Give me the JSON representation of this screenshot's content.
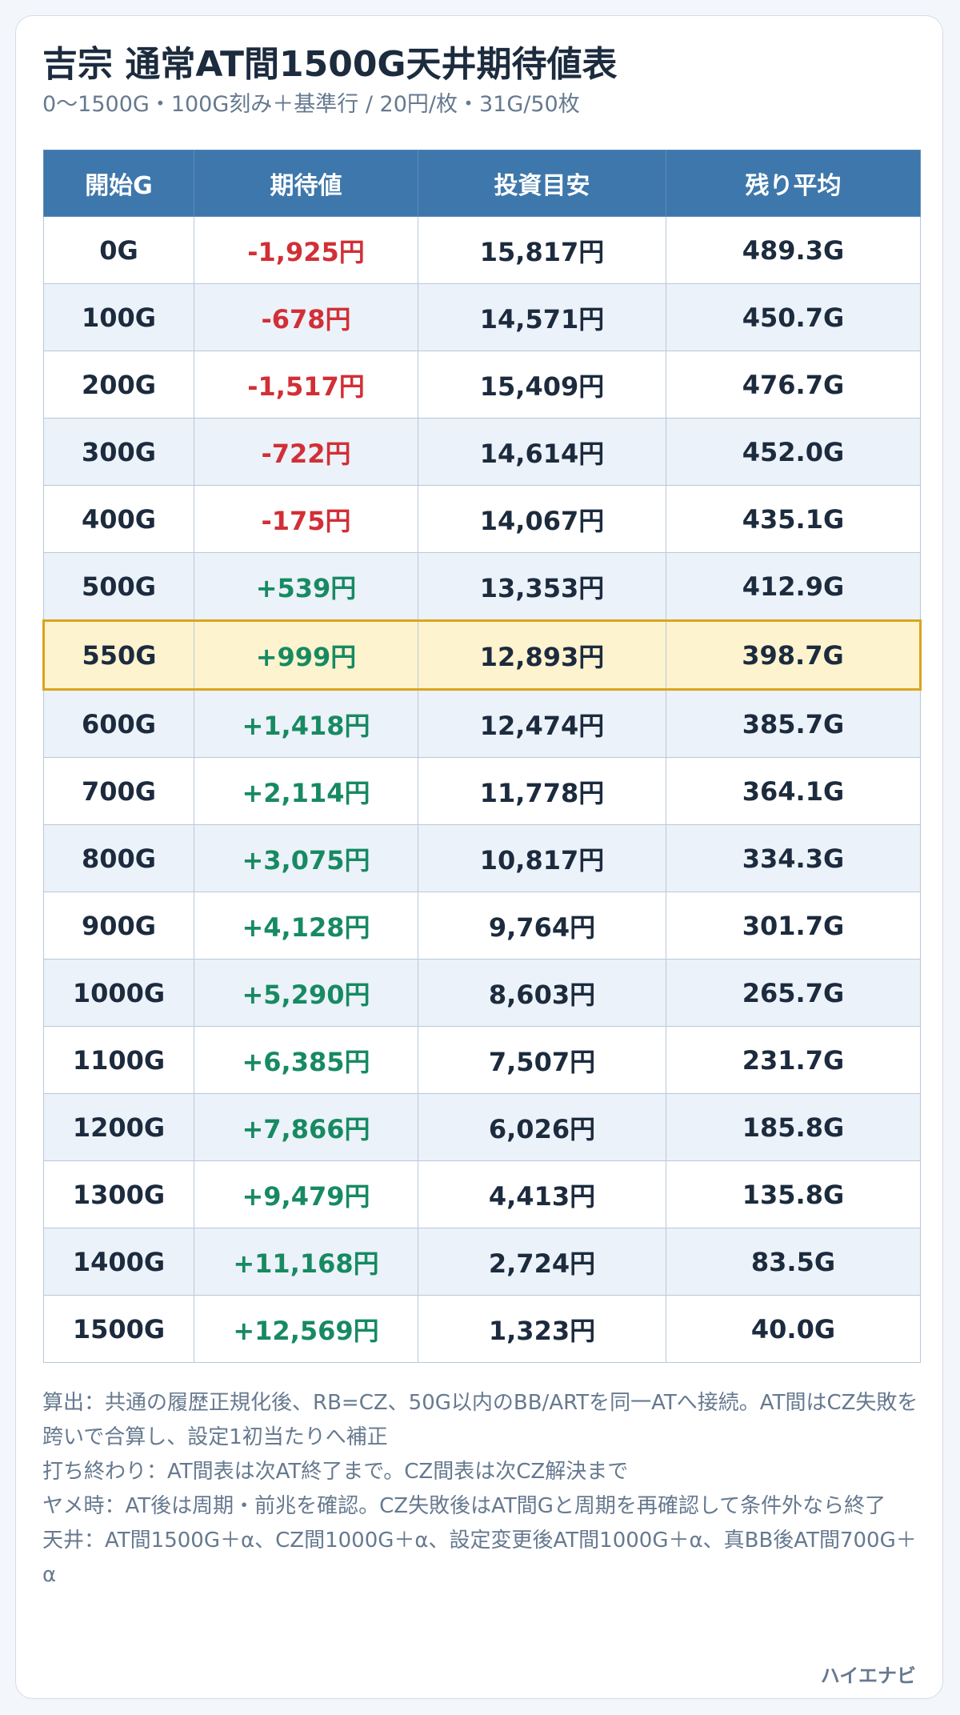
{
  "title": "吉宗 通常AT間1500G天井期待値表",
  "subtitle": "0〜1500G・100G刻み＋基準行 / 20円/枚・31G/50枚",
  "table": {
    "headers": [
      "開始G",
      "期待値",
      "投資目安",
      "残り平均"
    ],
    "rows": [
      {
        "start": "0G",
        "ev": "-1,925円",
        "sign": "neg",
        "invest": "15,817円",
        "remain": "489.3G"
      },
      {
        "start": "100G",
        "ev": "-678円",
        "sign": "neg",
        "invest": "14,571円",
        "remain": "450.7G"
      },
      {
        "start": "200G",
        "ev": "-1,517円",
        "sign": "neg",
        "invest": "15,409円",
        "remain": "476.7G"
      },
      {
        "start": "300G",
        "ev": "-722円",
        "sign": "neg",
        "invest": "14,614円",
        "remain": "452.0G"
      },
      {
        "start": "400G",
        "ev": "-175円",
        "sign": "neg",
        "invest": "14,067円",
        "remain": "435.1G"
      },
      {
        "start": "500G",
        "ev": "+539円",
        "sign": "pos",
        "invest": "13,353円",
        "remain": "412.9G"
      },
      {
        "start": "550G",
        "ev": "+999円",
        "sign": "pos",
        "invest": "12,893円",
        "remain": "398.7G",
        "highlight": true
      },
      {
        "start": "600G",
        "ev": "+1,418円",
        "sign": "pos",
        "invest": "12,474円",
        "remain": "385.7G"
      },
      {
        "start": "700G",
        "ev": "+2,114円",
        "sign": "pos",
        "invest": "11,778円",
        "remain": "364.1G"
      },
      {
        "start": "800G",
        "ev": "+3,075円",
        "sign": "pos",
        "invest": "10,817円",
        "remain": "334.3G"
      },
      {
        "start": "900G",
        "ev": "+4,128円",
        "sign": "pos",
        "invest": "9,764円",
        "remain": "301.7G"
      },
      {
        "start": "1000G",
        "ev": "+5,290円",
        "sign": "pos",
        "invest": "8,603円",
        "remain": "265.7G"
      },
      {
        "start": "1100G",
        "ev": "+6,385円",
        "sign": "pos",
        "invest": "7,507円",
        "remain": "231.7G"
      },
      {
        "start": "1200G",
        "ev": "+7,866円",
        "sign": "pos",
        "invest": "6,026円",
        "remain": "185.8G"
      },
      {
        "start": "1300G",
        "ev": "+9,479円",
        "sign": "pos",
        "invest": "4,413円",
        "remain": "135.8G"
      },
      {
        "start": "1400G",
        "ev": "+11,168円",
        "sign": "pos",
        "invest": "2,724円",
        "remain": "83.5G"
      },
      {
        "start": "1500G",
        "ev": "+12,569円",
        "sign": "pos",
        "invest": "1,323円",
        "remain": "40.0G"
      }
    ]
  },
  "notes": [
    "算出：共通の履歴正規化後、RB=CZ、50G以内のBB/ARTを同一ATへ接続。AT間はCZ失敗を跨いで合算し、設定1初当たりへ補正",
    "打ち終わり：AT間表は次AT終了まで。CZ間表は次CZ解決まで",
    "ヤメ時：AT後は周期・前兆を確認。CZ失敗後はAT間Gと周期を再確認して条件外なら終了",
    "天井：AT間1500G＋α、CZ間1000G＋α、設定変更後AT間1000G＋α、真BB後AT間700G＋α"
  ],
  "brand": "ハイエナビ",
  "colors": {
    "header_bg": "#3e77ab",
    "negative": "#d22f36",
    "positive": "#178a62",
    "highlight_bg": "#fdf3cf",
    "highlight_border": "#dba41e"
  }
}
